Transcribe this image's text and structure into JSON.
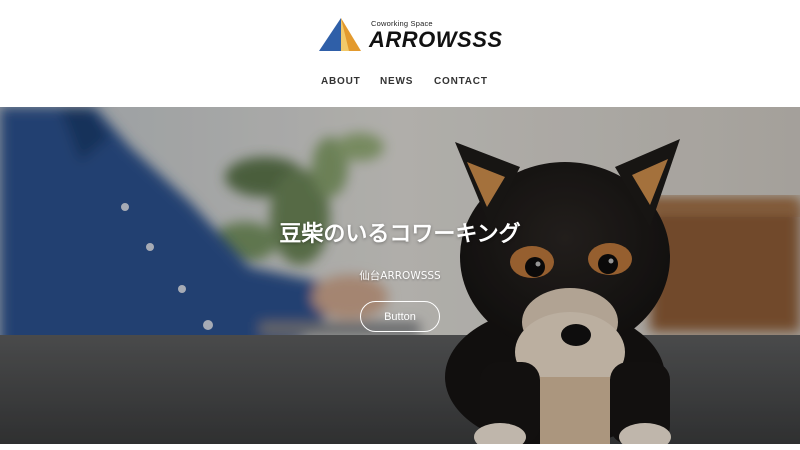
{
  "brand": {
    "tagline": "Coworking Space",
    "name": "ARROWSSS",
    "colors": {
      "triangle_left": "#2f5fa8",
      "triangle_right": "#e39a2e",
      "triangle_highlight": "#f2c96a"
    }
  },
  "nav": {
    "items": [
      {
        "label": "ABOUT"
      },
      {
        "label": "NEWS"
      },
      {
        "label": "CONTACT"
      }
    ]
  },
  "hero": {
    "title": "豆柴のいるコワーキング",
    "subtitle": "仙台ARROWSSS",
    "button_label": "Button",
    "image_subject": "shiba-puppy-and-person-at-desk"
  }
}
